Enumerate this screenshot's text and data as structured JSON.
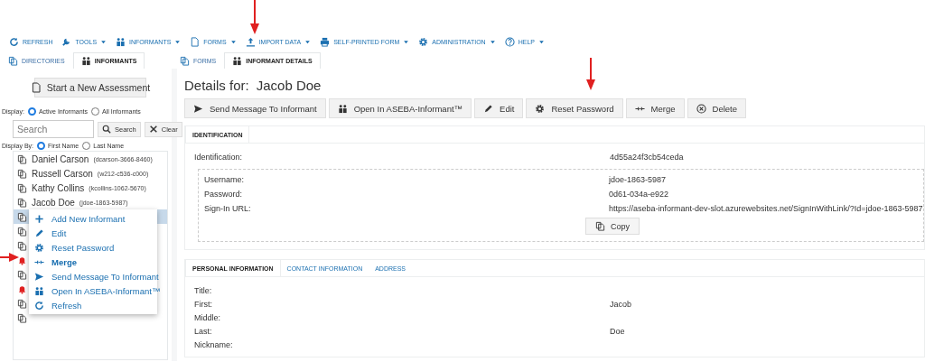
{
  "toolbar": [
    {
      "label": "REFRESH",
      "kind": "refresh",
      "dropdown": false
    },
    {
      "label": "TOOLS",
      "kind": "wrench",
      "dropdown": true
    },
    {
      "label": "INFORMANTS",
      "kind": "people",
      "dropdown": true
    },
    {
      "label": "FORMS",
      "kind": "doc",
      "dropdown": true
    },
    {
      "label": "IMPORT DATA",
      "kind": "upload",
      "dropdown": true
    },
    {
      "label": "SELF-PRINTED FORM",
      "kind": "printer",
      "dropdown": true
    },
    {
      "label": "ADMINISTRATION",
      "kind": "gear",
      "dropdown": true
    },
    {
      "label": "HELP",
      "kind": "help",
      "dropdown": true
    }
  ],
  "left_tabs": [
    {
      "label": "DIRECTORIES",
      "kind": "copy",
      "selected": false
    },
    {
      "label": "INFORMANTS",
      "kind": "people",
      "selected": true
    }
  ],
  "right_tabs": [
    {
      "label": "FORMS",
      "kind": "copy",
      "selected": false
    },
    {
      "label": "INFORMANT DETAILS",
      "kind": "people",
      "selected": true
    }
  ],
  "start_button": "Start a New Assessment",
  "display": {
    "label": "Display:",
    "options": [
      {
        "label": "Active Informants",
        "selected": true
      },
      {
        "label": "All Informants",
        "selected": false
      }
    ]
  },
  "search": {
    "placeholder": "Search",
    "buttons": [
      {
        "label": "Search",
        "kind": "search"
      },
      {
        "label": "Clear",
        "kind": "close"
      }
    ]
  },
  "display_by": {
    "label": "Display By:",
    "options": [
      {
        "label": "First Name",
        "selected": true
      },
      {
        "label": "Last Name",
        "selected": false
      }
    ]
  },
  "informants": [
    {
      "kind": "doc",
      "name": "Daniel Carson",
      "id": "(dcarson-3666-8460)",
      "selected": false
    },
    {
      "kind": "doc",
      "name": "Russell Carson",
      "id": "(w212-c536-c000)",
      "selected": false
    },
    {
      "kind": "doc",
      "name": "Kathy Collins",
      "id": "(kcollins-1062-5670)",
      "selected": false
    },
    {
      "kind": "doc",
      "name": "Jacob Doe",
      "id": "(jdoe-1863-5987)",
      "selected": false
    },
    {
      "kind": "doc",
      "selected": true
    },
    {
      "kind": "doc",
      "selected": false
    },
    {
      "kind": "doc",
      "selected": false
    },
    {
      "kind": "alert",
      "selected": false
    },
    {
      "kind": "doc",
      "selected": false
    },
    {
      "kind": "alert",
      "selected": false
    },
    {
      "kind": "doc",
      "selected": false
    },
    {
      "kind": "doc",
      "selected": false
    }
  ],
  "context_menu": [
    {
      "label": "Add New Informant",
      "kind": "plus",
      "emphasized": false
    },
    {
      "label": "Edit",
      "kind": "pencil",
      "emphasized": false
    },
    {
      "label": "Reset Password",
      "kind": "gear",
      "emphasized": false
    },
    {
      "label": "Merge",
      "kind": "merge",
      "emphasized": true
    },
    {
      "label": "Send Message To Informant",
      "kind": "send",
      "emphasized": false
    },
    {
      "label": "Open In ASEBA-Informant™",
      "kind": "people",
      "emphasized": false
    },
    {
      "label": "Refresh",
      "kind": "refresh",
      "emphasized": false
    }
  ],
  "details": {
    "heading": "Details for:",
    "name": "Jacob Doe"
  },
  "actions": [
    {
      "label": "Send Message To Informant",
      "kind": "send"
    },
    {
      "label": "Open In ASEBA-Informant™",
      "kind": "people"
    },
    {
      "label": "Edit",
      "kind": "pencil"
    },
    {
      "label": "Reset Password",
      "kind": "gear"
    },
    {
      "label": "Merge",
      "kind": "merge"
    },
    {
      "label": "Delete",
      "kind": "xcircle"
    }
  ],
  "identification_tabs": [
    {
      "label": "IDENTIFICATION",
      "selected": true
    }
  ],
  "identification": {
    "label": "Identification:",
    "value": "4d55a24f3cb54ceda"
  },
  "credentials": [
    {
      "label": "Username:",
      "value": "jdoe-1863-5987"
    },
    {
      "label": "Password:",
      "value": "0d61-034a-e922"
    },
    {
      "label": "Sign-In URL:",
      "value": "https://aseba-informant-dev-slot.azurewebsites.net/SignInWithLink/?Id=jdoe-1863-5987"
    }
  ],
  "copy_button": "Copy",
  "personal_tabs": [
    {
      "label": "PERSONAL INFORMATION",
      "selected": true
    },
    {
      "label": "CONTACT INFORMATION",
      "selected": false
    },
    {
      "label": "ADDRESS",
      "selected": false
    }
  ],
  "personal_fields": [
    {
      "label": "Title:"
    },
    {
      "label": "First:",
      "value": "Jacob"
    },
    {
      "label": "Middle:"
    },
    {
      "label": "Last:",
      "value": "Doe"
    },
    {
      "label": "Nickname:"
    }
  ]
}
